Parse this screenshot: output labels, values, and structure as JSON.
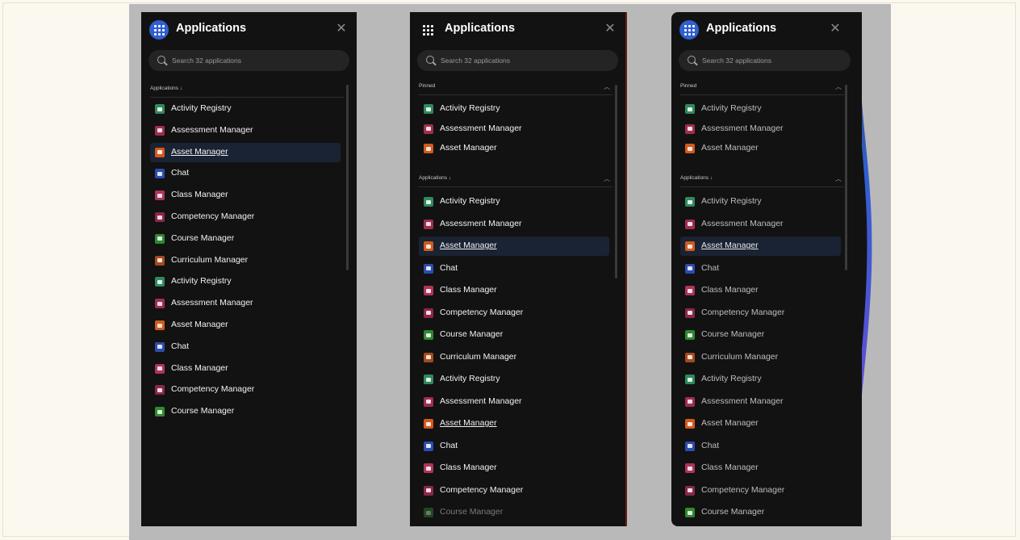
{
  "colors": {
    "accent": "#2f5fd0",
    "panel_bg": "#121212",
    "stage_bg": "#b9b9b9",
    "selected_bg": "#1a2333",
    "apps": {
      "activity": "#2f8a5d",
      "assessment": "#a12d4f",
      "asset": "#d3591c",
      "chat": "#2b4cb0",
      "class": "#b03458",
      "competency": "#8c2748",
      "course": "#2e8a2e",
      "curriculum": "#a84a1c"
    }
  },
  "panel1": {
    "title": "Applications",
    "search_placeholder": "Search 32 applications",
    "section_label": "Applications ↓",
    "items": [
      {
        "label": "Activity Registry",
        "icon": "activity-registry-icon",
        "color": "#2f8a5d"
      },
      {
        "label": "Assessment Manager",
        "icon": "assessment-manager-icon",
        "color": "#a12d4f"
      },
      {
        "label": "Asset Manager",
        "icon": "asset-manager-icon",
        "color": "#d3591c",
        "selected": true
      },
      {
        "label": "Chat",
        "icon": "chat-icon",
        "color": "#2b4cb0"
      },
      {
        "label": "Class Manager",
        "icon": "class-manager-icon",
        "color": "#b03458"
      },
      {
        "label": "Competency Manager",
        "icon": "competency-manager-icon",
        "color": "#8c2748"
      },
      {
        "label": "Course Manager",
        "icon": "course-manager-icon",
        "color": "#2e8a2e"
      },
      {
        "label": "Curriculum Manager",
        "icon": "curriculum-manager-icon",
        "color": "#a84a1c"
      },
      {
        "label": "Activity Registry",
        "icon": "activity-registry-icon",
        "color": "#2f8a5d"
      },
      {
        "label": "Assessment Manager",
        "icon": "assessment-manager-icon",
        "color": "#a12d4f"
      },
      {
        "label": "Asset Manager",
        "icon": "asset-manager-icon",
        "color": "#d3591c"
      },
      {
        "label": "Chat",
        "icon": "chat-icon",
        "color": "#2b4cb0"
      },
      {
        "label": "Class Manager",
        "icon": "class-manager-icon",
        "color": "#b03458"
      },
      {
        "label": "Competency Manager",
        "icon": "competency-manager-icon",
        "color": "#8c2748"
      },
      {
        "label": "Course Manager",
        "icon": "course-manager-icon",
        "color": "#2e8a2e"
      }
    ]
  },
  "panel2": {
    "title": "Applications",
    "search_placeholder": "Search 32 applications",
    "pinned_label": "Pinned",
    "section_label": "Applications ↓",
    "pinned_items": [
      {
        "label": "Activity Registry",
        "icon": "activity-registry-icon",
        "color": "#2f8a5d"
      },
      {
        "label": "Assessment Manager",
        "icon": "assessment-manager-icon",
        "color": "#a12d4f"
      },
      {
        "label": "Asset Manager",
        "icon": "asset-manager-icon",
        "color": "#d3591c"
      }
    ],
    "items": [
      {
        "label": "Activity Registry",
        "icon": "activity-registry-icon",
        "color": "#2f8a5d"
      },
      {
        "label": "Assessment Manager",
        "icon": "assessment-manager-icon",
        "color": "#a12d4f"
      },
      {
        "label": "Asset Manager",
        "icon": "asset-manager-icon",
        "color": "#d3591c",
        "selected": true
      },
      {
        "label": "Chat",
        "icon": "chat-icon",
        "color": "#2b4cb0"
      },
      {
        "label": "Class Manager",
        "icon": "class-manager-icon",
        "color": "#b03458"
      },
      {
        "label": "Competency Manager",
        "icon": "competency-manager-icon",
        "color": "#8c2748"
      },
      {
        "label": "Course Manager",
        "icon": "course-manager-icon",
        "color": "#2e8a2e"
      },
      {
        "label": "Curriculum Manager",
        "icon": "curriculum-manager-icon",
        "color": "#a84a1c"
      },
      {
        "label": "Activity Registry",
        "icon": "activity-registry-icon",
        "color": "#2f8a5d"
      },
      {
        "label": "Assessment Manager",
        "icon": "assessment-manager-icon",
        "color": "#a12d4f"
      },
      {
        "label": "Asset Manager",
        "icon": "asset-manager-icon",
        "color": "#d3591c",
        "underlined": true
      },
      {
        "label": "Chat",
        "icon": "chat-icon",
        "color": "#2b4cb0"
      },
      {
        "label": "Class Manager",
        "icon": "class-manager-icon",
        "color": "#b03458"
      },
      {
        "label": "Competency Manager",
        "icon": "competency-manager-icon",
        "color": "#8c2748"
      },
      {
        "label": "Course Manager",
        "icon": "course-manager-icon",
        "color": "#2e8a2e",
        "faded": true
      }
    ]
  },
  "panel3": {
    "title": "Applications",
    "search_placeholder": "Search 32 applications",
    "pinned_label": "Pinned",
    "section_label": "Applications ↓",
    "pinned_items": [
      {
        "label": "Activity Registry",
        "icon": "activity-registry-icon",
        "color": "#2f8a5d"
      },
      {
        "label": "Assessment Manager",
        "icon": "assessment-manager-icon",
        "color": "#a12d4f"
      },
      {
        "label": "Asset Manager",
        "icon": "asset-manager-icon",
        "color": "#d3591c"
      }
    ],
    "items": [
      {
        "label": "Activity Registry",
        "icon": "activity-registry-icon",
        "color": "#2f8a5d"
      },
      {
        "label": "Assessment Manager",
        "icon": "assessment-manager-icon",
        "color": "#a12d4f"
      },
      {
        "label": "Asset Manager",
        "icon": "asset-manager-icon",
        "color": "#d3591c",
        "selected": true
      },
      {
        "label": "Chat",
        "icon": "chat-icon",
        "color": "#2b4cb0"
      },
      {
        "label": "Class Manager",
        "icon": "class-manager-icon",
        "color": "#b03458"
      },
      {
        "label": "Competency Manager",
        "icon": "competency-manager-icon",
        "color": "#8c2748"
      },
      {
        "label": "Course Manager",
        "icon": "course-manager-icon",
        "color": "#2e8a2e"
      },
      {
        "label": "Curriculum Manager",
        "icon": "curriculum-manager-icon",
        "color": "#a84a1c"
      },
      {
        "label": "Activity Registry",
        "icon": "activity-registry-icon",
        "color": "#2f8a5d"
      },
      {
        "label": "Assessment Manager",
        "icon": "assessment-manager-icon",
        "color": "#a12d4f"
      },
      {
        "label": "Asset Manager",
        "icon": "asset-manager-icon",
        "color": "#d3591c"
      },
      {
        "label": "Chat",
        "icon": "chat-icon",
        "color": "#2b4cb0"
      },
      {
        "label": "Class Manager",
        "icon": "class-manager-icon",
        "color": "#b03458"
      },
      {
        "label": "Competency Manager",
        "icon": "competency-manager-icon",
        "color": "#8c2748"
      },
      {
        "label": "Course Manager",
        "icon": "course-manager-icon",
        "color": "#2e8a2e"
      }
    ]
  }
}
